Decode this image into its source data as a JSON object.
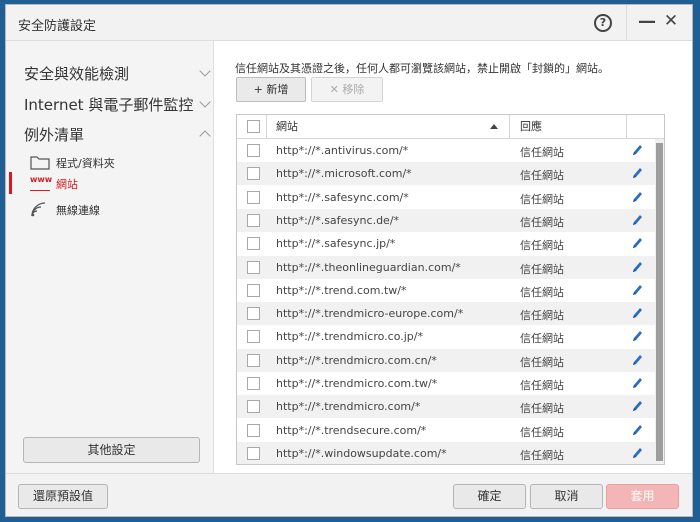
{
  "window": {
    "title": "安全防護設定"
  },
  "titlebar": {
    "help_label": "?",
    "minimize_label": "—",
    "close_label": "✕"
  },
  "sidebar": {
    "categories": [
      {
        "label": "安全與效能檢測",
        "expanded": false
      },
      {
        "label": "Internet 與電子郵件監控",
        "expanded": false
      },
      {
        "label": "例外清單",
        "expanded": true
      }
    ],
    "items": [
      {
        "label": "程式/資料夾",
        "icon": "folder-icon",
        "active": false
      },
      {
        "label": "網站",
        "icon": "www-icon",
        "icon_text": "www",
        "active": true
      },
      {
        "label": "無線連線",
        "icon": "wifi-icon",
        "active": false
      }
    ],
    "other_settings_label": "其他設定"
  },
  "main": {
    "description": "信任網站及其憑證之後，任何人都可瀏覽該網站，禁止開啟「封鎖的」網站。",
    "add_label": "+ 新增",
    "remove_label": "✕ 移除",
    "table": {
      "columns": {
        "site": "網站",
        "action": "回應"
      },
      "rows": [
        {
          "url": "http*://*.antivirus.com/*",
          "action": "信任網站"
        },
        {
          "url": "http*://*.microsoft.com/*",
          "action": "信任網站"
        },
        {
          "url": "http*://*.safesync.com/*",
          "action": "信任網站"
        },
        {
          "url": "http*://*.safesync.de/*",
          "action": "信任網站"
        },
        {
          "url": "http*://*.safesync.jp/*",
          "action": "信任網站"
        },
        {
          "url": "http*://*.theonlineguardian.com/*",
          "action": "信任網站"
        },
        {
          "url": "http*://*.trend.com.tw/*",
          "action": "信任網站"
        },
        {
          "url": "http*://*.trendmicro-europe.com/*",
          "action": "信任網站"
        },
        {
          "url": "http*://*.trendmicro.co.jp/*",
          "action": "信任網站"
        },
        {
          "url": "http*://*.trendmicro.com.cn/*",
          "action": "信任網站"
        },
        {
          "url": "http*://*.trendmicro.com.tw/*",
          "action": "信任網站"
        },
        {
          "url": "http*://*.trendmicro.com/*",
          "action": "信任網站"
        },
        {
          "url": "http*://*.trendsecure.com/*",
          "action": "信任網站"
        },
        {
          "url": "http*://*.windowsupdate.com/*",
          "action": "信任網站"
        }
      ]
    }
  },
  "footer": {
    "restore_label": "還原預設值",
    "ok_label": "確定",
    "cancel_label": "取消",
    "apply_label": "套用"
  },
  "colors": {
    "accent": "#d71920",
    "apply_disabled": "#f3b5b5",
    "desktop": "#1f5f94"
  }
}
